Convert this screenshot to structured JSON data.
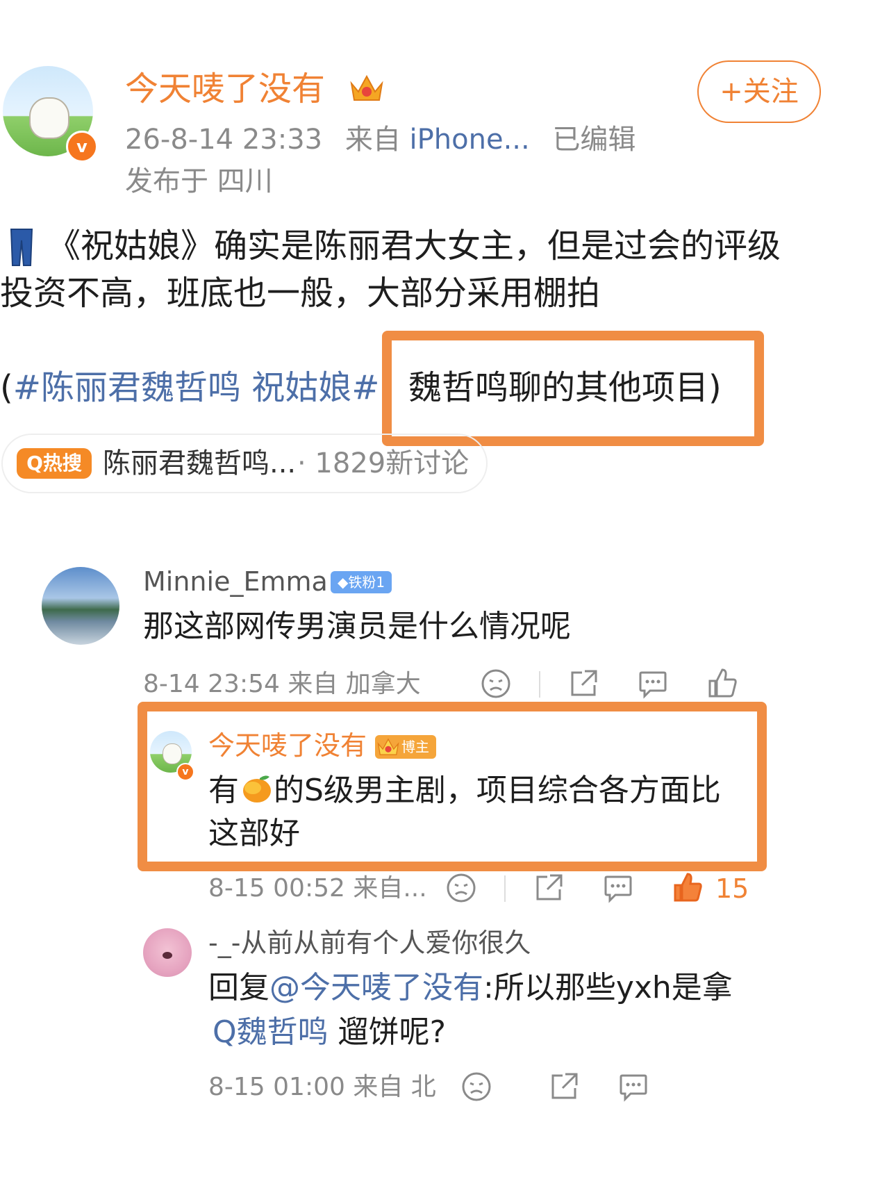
{
  "post": {
    "author": "今天唛了没有",
    "follow_label": "+关注",
    "time": "26-8-14 23:33",
    "from_label": "来自",
    "device": "iPhone...",
    "edited": "已编辑",
    "location": "发布于 四川",
    "body_line1": "《祝姑娘》确实是陈丽君大女主，但是过会的评级",
    "body_line2": "投资不高，班底也一般，大部分采用棚拍",
    "paren_open": "(",
    "hashtag": "#陈丽君魏哲鸣 祝姑娘#",
    "tail": "魏哲鸣聊的其他项目)",
    "hot_badge": "Q热搜",
    "hot_topic": "陈丽君魏哲鸣...",
    "hot_count": "· 1829新讨论"
  },
  "comment1": {
    "user": "Minnie_Emma",
    "badge": "◆铁粉1",
    "text": "那这部网传男演员是什么情况呢",
    "meta": "8-14 23:54 来自 加拿大"
  },
  "reply1": {
    "user": "今天唛了没有",
    "badge": "博主",
    "text_a": "有",
    "text_b": "的S级男主剧，项目综合各方面比",
    "text_line2": "这部好",
    "meta": "8-15 00:52 来自...",
    "likes": "15"
  },
  "reply2": {
    "user": "-_-从前从前有个人爱你很久",
    "prefix": "回复",
    "mention": "@今天唛了没有",
    "text_a": ":所以那些yxh是拿",
    "search_word": "Q魏哲鸣",
    "text_b": " 遛饼呢?",
    "meta": "8-15 01:00 来自 北"
  },
  "colors": {
    "accent": "#f08234",
    "link": "#4d6fa8",
    "highlight_box": "#f08d44",
    "meta_gray": "#8a8a8a"
  },
  "icons": [
    "dislike-icon",
    "share-icon",
    "comment-icon",
    "like-icon",
    "verified-v-icon",
    "crown-icon"
  ]
}
